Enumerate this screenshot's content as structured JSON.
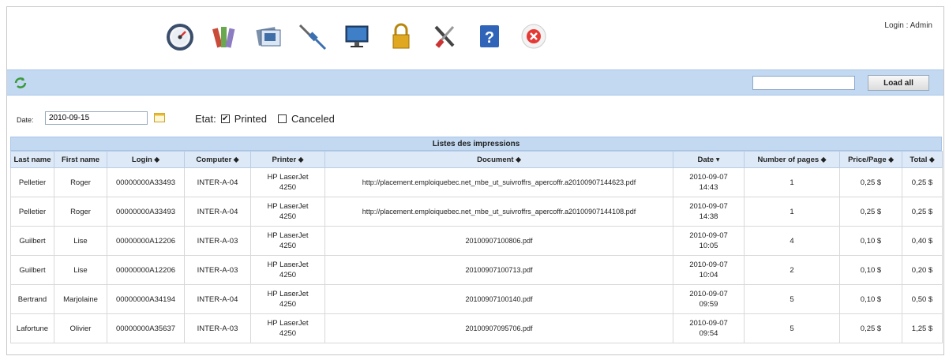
{
  "header": {
    "login_text": "Login : Admin",
    "icons": [
      "dashboard-icon",
      "books-icon",
      "folders-icon",
      "cable-icon",
      "monitor-icon",
      "lock-icon",
      "tools-icon",
      "help-icon",
      "close-icon"
    ]
  },
  "search": {
    "value": "",
    "load_all_label": "Load all"
  },
  "filters": {
    "date_label": "Date:",
    "date_value": "2010-09-15",
    "etat_label": "Etat:",
    "printed_label": "Printed",
    "printed_checked": "✔",
    "canceled_label": "Canceled"
  },
  "table": {
    "caption": "Listes des impressions",
    "headers": [
      "Last name",
      "First name",
      "Login ⬥",
      "Computer ⬥",
      "Printer ⬥",
      "Document ⬥",
      "Date ▾",
      "Number of pages ⬥",
      "Price/Page ⬥",
      "Total ⬥"
    ],
    "rows": [
      {
        "last": "Pelletier",
        "first": "Roger",
        "login": "00000000A33493",
        "computer": "INTER-A-04",
        "printer1": "HP LaserJet",
        "printer2": "4250",
        "document": "http://placement.emploiquebec.net_mbe_ut_suivroffrs_apercoffr.a20100907144623.pdf",
        "date1": "2010-09-07",
        "date2": "14:43",
        "pages": "1",
        "price": "0,25 $",
        "total": "0,25 $"
      },
      {
        "last": "Pelletier",
        "first": "Roger",
        "login": "00000000A33493",
        "computer": "INTER-A-04",
        "printer1": "HP LaserJet",
        "printer2": "4250",
        "document": "http://placement.emploiquebec.net_mbe_ut_suivroffrs_apercoffr.a20100907144108.pdf",
        "date1": "2010-09-07",
        "date2": "14:38",
        "pages": "1",
        "price": "0,25 $",
        "total": "0,25 $"
      },
      {
        "last": "Guilbert",
        "first": "Lise",
        "login": "00000000A12206",
        "computer": "INTER-A-03",
        "printer1": "HP LaserJet",
        "printer2": "4250",
        "document": "20100907100806.pdf",
        "date1": "2010-09-07",
        "date2": "10:05",
        "pages": "4",
        "price": "0,10 $",
        "total": "0,40 $"
      },
      {
        "last": "Guilbert",
        "first": "Lise",
        "login": "00000000A12206",
        "computer": "INTER-A-03",
        "printer1": "HP LaserJet",
        "printer2": "4250",
        "document": "20100907100713.pdf",
        "date1": "2010-09-07",
        "date2": "10:04",
        "pages": "2",
        "price": "0,10 $",
        "total": "0,20 $"
      },
      {
        "last": "Bertrand",
        "first": "Marjolaine",
        "login": "00000000A34194",
        "computer": "INTER-A-04",
        "printer1": "HP LaserJet",
        "printer2": "4250",
        "document": "20100907100140.pdf",
        "date1": "2010-09-07",
        "date2": "09:59",
        "pages": "5",
        "price": "0,10 $",
        "total": "0,50 $"
      },
      {
        "last": "Lafortune",
        "first": "Olivier",
        "login": "00000000A35637",
        "computer": "INTER-A-03",
        "printer1": "HP LaserJet",
        "printer2": "4250",
        "document": "20100907095706.pdf",
        "date1": "2010-09-07",
        "date2": "09:54",
        "pages": "5",
        "price": "0,25 $",
        "total": "1,25 $"
      }
    ]
  },
  "colors": {
    "bar_blue": "#c3d9f2",
    "header_blue": "#dde9f6"
  }
}
